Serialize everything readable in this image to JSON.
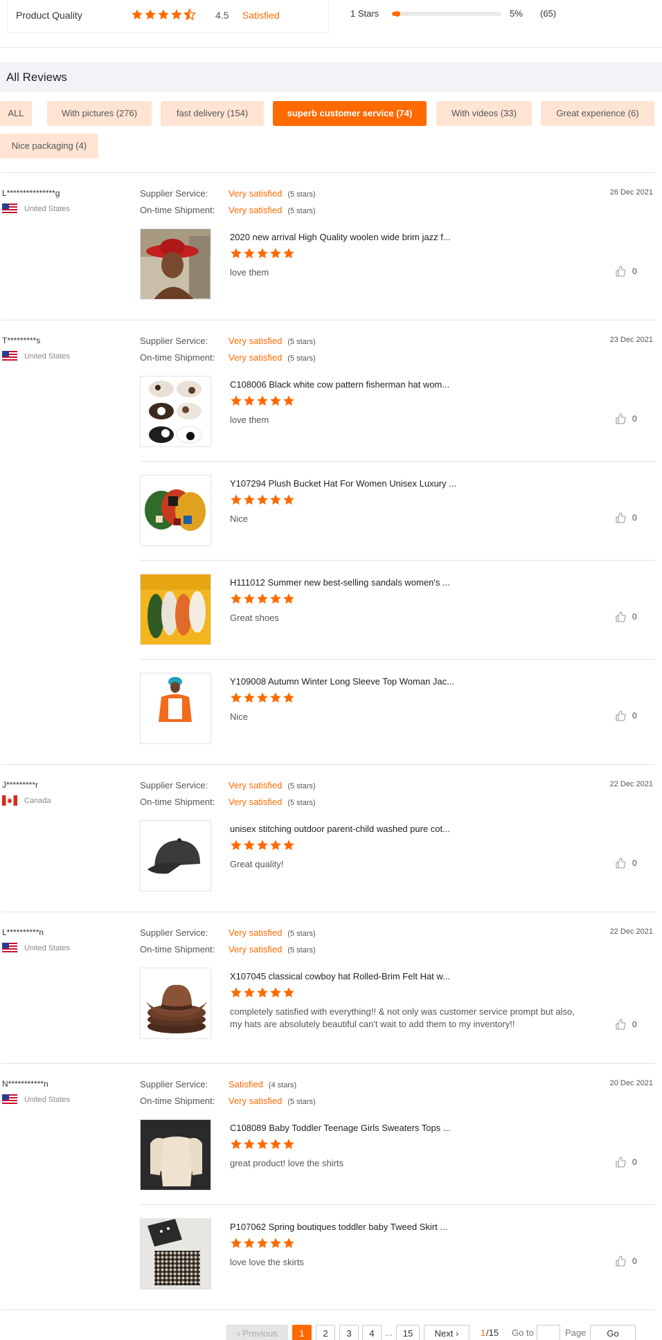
{
  "summary": {
    "label": "Product Quality",
    "rating": "4.5",
    "rating_value": 4.5,
    "rating_text": "Satisfied",
    "breakdown": [
      {
        "label": "1 Stars",
        "pct": "5%",
        "pct_value": 0.05,
        "count": "(65)"
      }
    ]
  },
  "all_reviews_title": "All Reviews",
  "filters": [
    {
      "label": "ALL",
      "active": false
    },
    {
      "label": "With pictures (276)",
      "active": false
    },
    {
      "label": "fast delivery (154)",
      "active": false
    },
    {
      "label": "superb customer service (74)",
      "active": true
    },
    {
      "label": "With videos (33)",
      "active": false
    },
    {
      "label": "Great experience (6)",
      "active": false
    },
    {
      "label": "Nice packaging (4)",
      "active": false
    }
  ],
  "service_labels": {
    "supplier": "Supplier Service:",
    "shipment": "On-time Shipment:"
  },
  "reviews": [
    {
      "user": "L***************g",
      "country": "United States",
      "flag": "us-flag",
      "date": "26 Dec 2021",
      "supplier_value": "Very satisfied",
      "supplier_stars": "(5 stars)",
      "shipment_value": "Very satisfied",
      "shipment_stars": "(5 stars)",
      "items": [
        {
          "title": "2020 new arrival High Quality woolen wide brim jazz f...",
          "text": "love them",
          "likes": "0",
          "stars": 5,
          "image": "red-hat-woman-photo"
        }
      ]
    },
    {
      "user": "T*********s",
      "country": "United States",
      "flag": "us-flag",
      "date": "23 Dec 2021",
      "supplier_value": "Very satisfied",
      "supplier_stars": "(5 stars)",
      "shipment_value": "Very satisfied",
      "shipment_stars": "(5 stars)",
      "items": [
        {
          "title": "C108006 Black white cow pattern fisherman hat wom...",
          "text": "love them",
          "likes": "0",
          "stars": 5,
          "image": "cow-pattern-hats-photo"
        },
        {
          "title": "Y107294 Plush Bucket Hat For Women Unisex Luxury ...",
          "text": "Nice",
          "likes": "0",
          "stars": 5,
          "image": "plush-bucket-hats-photo"
        },
        {
          "title": "H111012 Summer new best-selling sandals women's ...",
          "text": "Great shoes",
          "likes": "0",
          "stars": 5,
          "image": "bubble-sandals-photo"
        },
        {
          "title": "Y109008 Autumn Winter Long Sleeve Top Woman Jac...",
          "text": "Nice",
          "likes": "0",
          "stars": 5,
          "image": "orange-jacket-woman-photo"
        }
      ]
    },
    {
      "user": "J*********r",
      "country": "Canada",
      "flag": "ca-flag",
      "date": "22 Dec 2021",
      "supplier_value": "Very satisfied",
      "supplier_stars": "(5 stars)",
      "shipment_value": "Very satisfied",
      "shipment_stars": "(5 stars)",
      "items": [
        {
          "title": "unisex stitching outdoor parent-child washed pure cot...",
          "text": "Great quality!",
          "likes": "0",
          "stars": 5,
          "image": "black-cap-photo"
        }
      ]
    },
    {
      "user": "L**********n",
      "country": "United States",
      "flag": "us-flag",
      "date": "22 Dec 2021",
      "supplier_value": "Very satisfied",
      "supplier_stars": "(5 stars)",
      "shipment_value": "Very satisfied",
      "shipment_stars": "(5 stars)",
      "items": [
        {
          "title": "X107045 classical cowboy hat Rolled-Brim Felt Hat w...",
          "text": "completely satisfied with everything!! &  not only was customer service prompt but also, my hats are absolutely beautiful can't wait to add them to my inventory!!",
          "likes": "0",
          "stars": 5,
          "image": "cowboy-hats-photo"
        }
      ]
    },
    {
      "user": "N***********n",
      "country": "United States",
      "flag": "us-flag",
      "date": "20 Dec 2021",
      "supplier_value": "Satisfied",
      "supplier_stars": "(4 stars)",
      "shipment_value": "Very satisfied",
      "shipment_stars": "(5 stars)",
      "items": [
        {
          "title": "C108089 Baby Toddler Teenage Girls Sweaters Tops ...",
          "text": "great product! love the shirts",
          "likes": "0",
          "stars": 5,
          "image": "cream-sweater-photo"
        },
        {
          "title": "P107062 Spring boutiques toddler baby Tweed Skirt ...",
          "text": "love love the skirts",
          "likes": "0",
          "stars": 5,
          "image": "tweed-skirts-photo"
        }
      ]
    }
  ],
  "pagination": {
    "previous": "Previous",
    "pages": [
      "1",
      "2",
      "3",
      "4"
    ],
    "ellipsis": "...",
    "last": "15",
    "next": "Next",
    "current": "1",
    "total": "/15",
    "goto_label": "Go to",
    "page_label": "Page",
    "go_button": "Go"
  },
  "colors": {
    "accent": "#ff6a00",
    "chip_bg": "#ffe4d4",
    "header_bg": "#f2f3f7"
  }
}
